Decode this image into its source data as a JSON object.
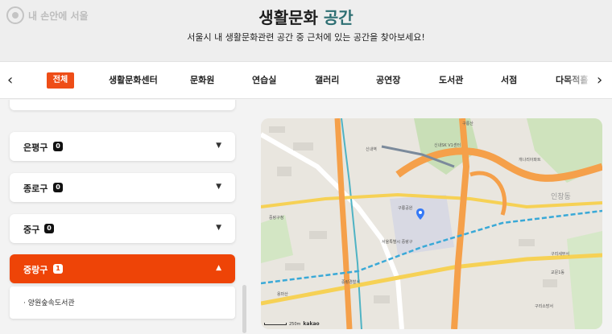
{
  "logo": {
    "text": "내 손안에 서울"
  },
  "header": {
    "title_main": "생활문화",
    "title_accent": "공간",
    "subtitle": "서울시 내 생활문화관련 공간 중 근처에 있는 공간을 찾아보세요!"
  },
  "tabs": {
    "prev_icon": "chevron-left-icon",
    "next_icon": "chevron-right-icon",
    "items": [
      "전체",
      "생활문화센터",
      "문화원",
      "연습실",
      "갤러리",
      "공연장",
      "도서관",
      "서점",
      "다목적홀"
    ],
    "active_index": 0
  },
  "districts": [
    {
      "name": "은평구",
      "count": "0",
      "open": false
    },
    {
      "name": "종로구",
      "count": "0",
      "open": false
    },
    {
      "name": "중구",
      "count": "0",
      "open": false
    },
    {
      "name": "중랑구",
      "count": "1",
      "open": true,
      "items": [
        "· 양원숲속도서관"
      ]
    }
  ],
  "map": {
    "labels": [
      "구룡산",
      "신내SK V1센터",
      "신내역",
      "중랑구청",
      "구룡공원",
      "서울특별시 중랑구",
      "인창동",
      "개나리아파트",
      "구리세무서",
      "중랑경찰서",
      "용마산",
      "교문1동",
      "구리소방서"
    ],
    "attribution": "kakao",
    "scale": "250m",
    "pin_color": "#3579f6"
  },
  "colors": {
    "accent": "#ee4407",
    "title_accent": "#2e6f73",
    "road_major": "#f5a04a",
    "road_minor": "#f6d155",
    "park": "#c9dfb7"
  }
}
